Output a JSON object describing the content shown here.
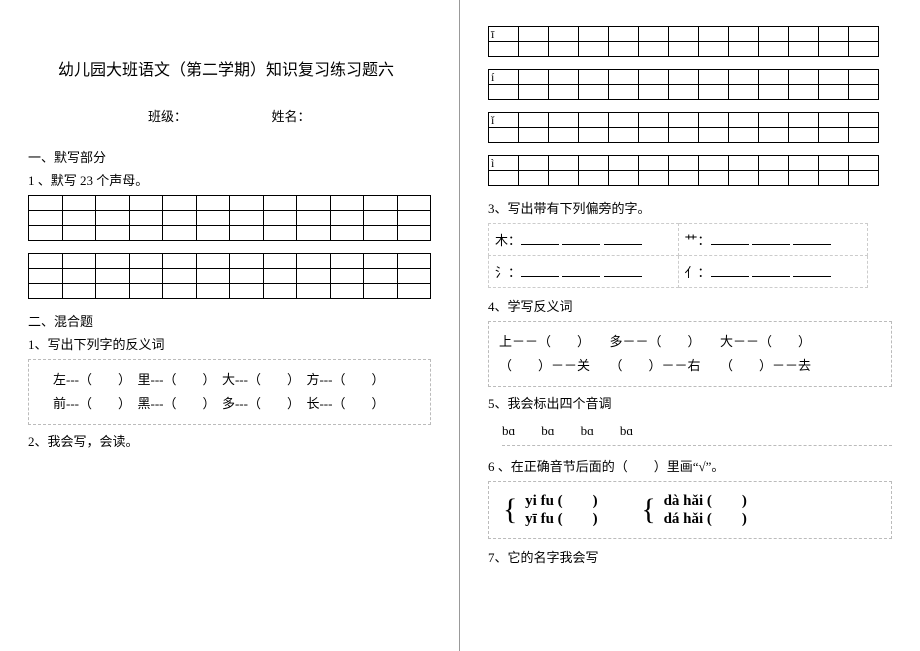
{
  "title": "幼儿园大班语文（第二学期）知识复习练习题六",
  "meta": {
    "class_label": "班级：",
    "name_label": "姓名："
  },
  "left": {
    "s1_h": "一、默写部分",
    "s1_q1": "1 、默写 23 个声母。",
    "s2_h": "二、混合题",
    "s2_q1": "1、写出下列字的反义词",
    "antonyms_line1": "左---（　　）　里---（　　）　大---（　　）　方---（　　）",
    "antonyms_line2": "前---（　　）　黑---（　　）　多---（　　）　长---（　　）",
    "s2_q2": "2、我会写，会读。"
  },
  "right": {
    "pinyin_cells": [
      "ī",
      "í",
      "ǐ",
      "ì"
    ],
    "q3": "3、写出带有下列偏旁的字。",
    "radical_a": "木：",
    "radical_b": "艹：",
    "radical_c": "氵：",
    "radical_d": "亻：",
    "q4": "4、学写反义词",
    "ant2_line1": "上－－（　　）　　多－－（　　）　　大－－（　　）",
    "ant2_line2": "（　　）－－关　　（　　）－－右　　（　　）－－去",
    "q5": "5、我会标出四个音调",
    "q5_line": "bɑ　　bɑ　　bɑ　　bɑ",
    "q6": "6 、在正确音节后面的（　　）里画“√”。",
    "p1a": "yi fu (　　)",
    "p1b": "yī fu (　　)",
    "p2a": "dà hǎi (　　)",
    "p2b": "dá hǎi (　　)",
    "q7": "7、它的名字我会写"
  }
}
